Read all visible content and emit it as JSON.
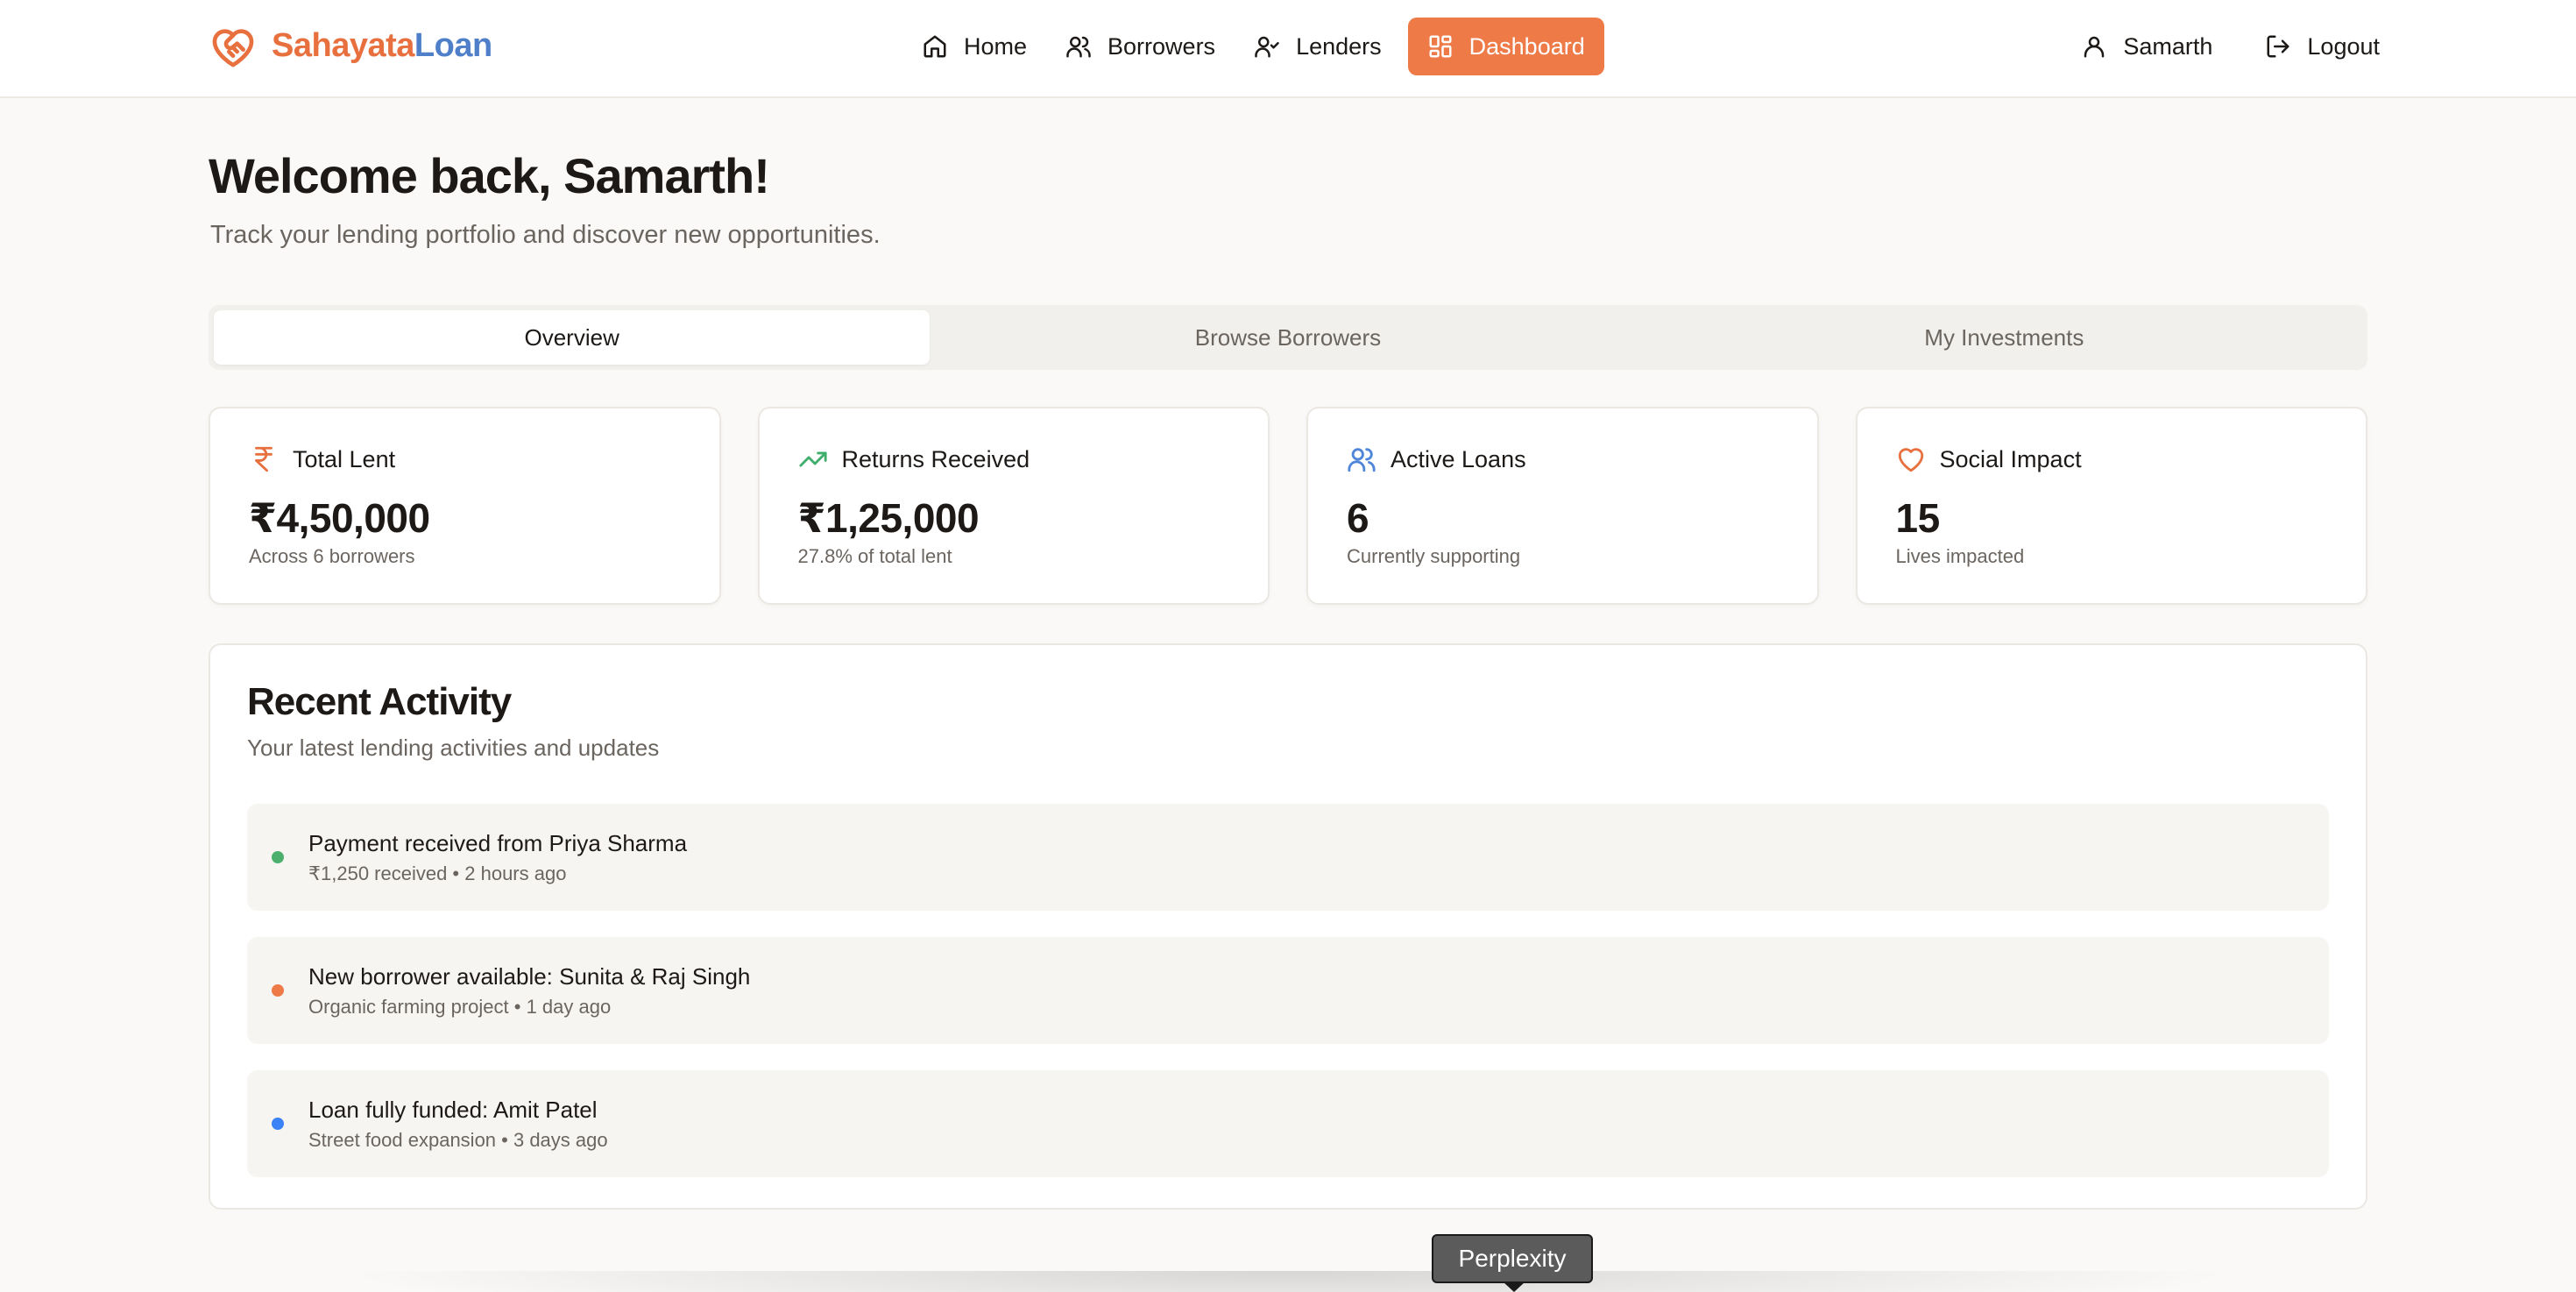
{
  "brand": {
    "name_part1": "Sahayata",
    "name_part2": "Loan",
    "accent": "#ee7a47",
    "secondary": "#4f7fc9"
  },
  "nav": {
    "items": [
      {
        "label": "Home",
        "icon": "home-icon"
      },
      {
        "label": "Borrowers",
        "icon": "users-icon"
      },
      {
        "label": "Lenders",
        "icon": "user-check-icon"
      },
      {
        "label": "Dashboard",
        "icon": "grid-icon",
        "active": true
      }
    ],
    "user_label": "Samarth",
    "logout_label": "Logout"
  },
  "header": {
    "title": "Welcome back, Samarth!",
    "subtitle": "Track your lending portfolio and discover new opportunities."
  },
  "tabs": [
    {
      "label": "Overview",
      "active": true
    },
    {
      "label": "Browse Borrowers"
    },
    {
      "label": "My Investments"
    }
  ],
  "stats": [
    {
      "label": "Total Lent",
      "value": "₹4,50,000",
      "note": "Across 6 borrowers",
      "icon": "rupee-icon",
      "color": "#e8703f"
    },
    {
      "label": "Returns Received",
      "value": "₹1,25,000",
      "note": "27.8% of total lent",
      "icon": "trending-up-icon",
      "color": "#3fae6a"
    },
    {
      "label": "Active Loans",
      "value": "6",
      "note": "Currently supporting",
      "icon": "users-icon",
      "color": "#4f86d9"
    },
    {
      "label": "Social Impact",
      "value": "15",
      "note": "Lives impacted",
      "icon": "heart-icon",
      "color": "#e8703f"
    }
  ],
  "activity": {
    "title": "Recent Activity",
    "subtitle": "Your latest lending activities and updates",
    "items": [
      {
        "title": "Payment received from Priya Sharma",
        "meta": "₹1,250 received • 2 hours ago",
        "color": "#4caf6e"
      },
      {
        "title": "New borrower available: Sunita & Raj Singh",
        "meta": "Organic farming project • 1 day ago",
        "color": "#ee7a47"
      },
      {
        "title": "Loan fully funded: Amit Patel",
        "meta": "Street food expansion • 3 days ago",
        "color": "#3b82f6"
      }
    ]
  },
  "tooltip": {
    "label": "Perplexity"
  }
}
